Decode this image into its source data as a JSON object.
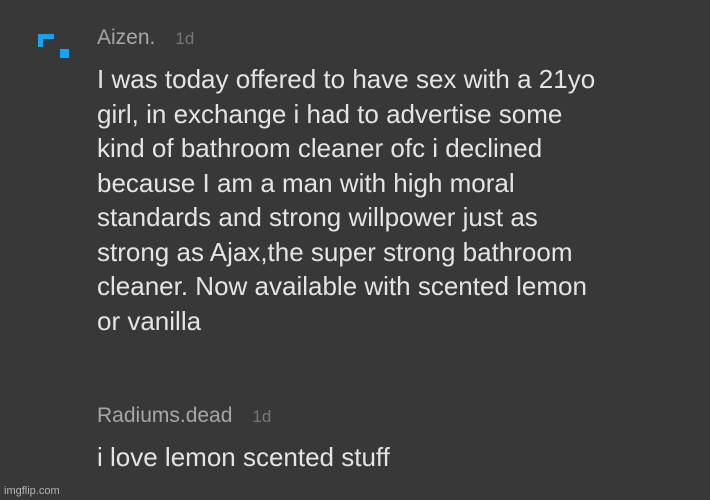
{
  "comments": [
    {
      "username": "Aizen.",
      "time": "1d",
      "avatar_icon": "blue-bracket-logo-icon",
      "text": "I was today offered to have sex with a 21yo\ngirl, in exchange i had to advertise some\nkind of bathroom cleaner ofc i declined\nbecause I am a man with high moral\nstandards and strong willpower just as\nstrong as Ajax,the super strong bathroom\ncleaner. Now available with scented lemon\nor vanilla"
    },
    {
      "username": "Radiums.dead",
      "time": "1d",
      "text": "i love lemon scented stuff"
    }
  ],
  "watermark": "imgflip.com",
  "colors": {
    "background": "#383838",
    "avatar_accent": "#1da1e8",
    "username": "#a7a7a7",
    "timestamp": "#777777",
    "body_text": "#e4e4e4"
  }
}
